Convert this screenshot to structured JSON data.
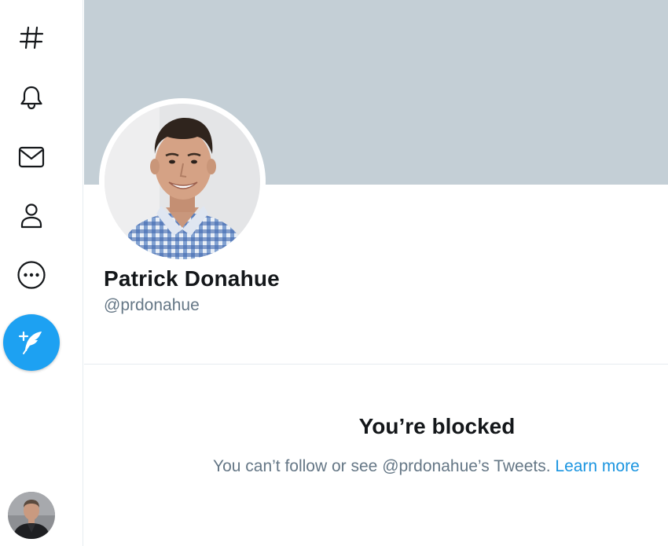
{
  "nav": {
    "items": [
      {
        "name": "explore",
        "icon": "hashtag-icon"
      },
      {
        "name": "notifications",
        "icon": "bell-icon"
      },
      {
        "name": "messages",
        "icon": "envelope-icon"
      },
      {
        "name": "profile",
        "icon": "person-icon"
      },
      {
        "name": "more",
        "icon": "more-dots-icon"
      }
    ],
    "compose_icon": "feather-plus-icon",
    "account_avatar": "account-avatar"
  },
  "profile": {
    "display_name": "Patrick Donahue",
    "handle": "@prdonahue",
    "banner_color": "#c4cfd6"
  },
  "blocked": {
    "title": "You’re blocked",
    "message": "You can’t follow or see @prdonahue’s Tweets.",
    "learn_more": "Learn more"
  },
  "colors": {
    "accent": "#1da1f2",
    "link": "#1b95e0",
    "text_primary": "#14171a",
    "text_secondary": "#657786"
  }
}
